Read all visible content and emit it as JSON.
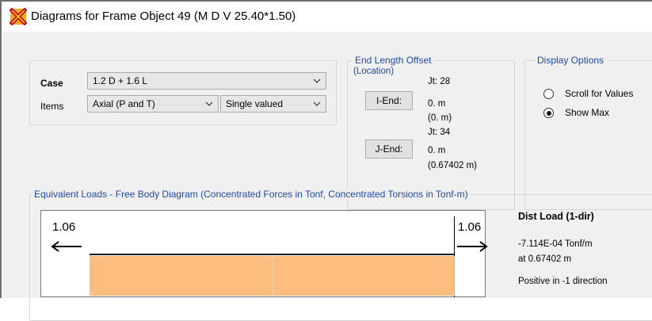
{
  "window": {
    "title": "Diagrams for Frame Object 49  (M D V 25.40*1.50)",
    "app_icon": "sap2000-x-icon"
  },
  "case_group": {
    "case_label": "Case",
    "case_value": "1.2 D + 1.6 L",
    "items_label": "Items",
    "items_value": "Axial (P and T)",
    "valued_value": "Single valued"
  },
  "end_offset": {
    "title": "End Length Offset",
    "location_label": "(Location)",
    "i_end": {
      "button": "I-End:",
      "jt": "Jt:  28",
      "value": "0. m",
      "location": "(0. m)"
    },
    "j_end": {
      "button": "J-End:",
      "jt": "Jt:  34",
      "value": "0. m",
      "location": "(0.67402 m)"
    }
  },
  "display_options": {
    "title": "Display Options",
    "options": [
      {
        "label": "Scroll for Values",
        "selected": false
      },
      {
        "label": "Show Max",
        "selected": true
      }
    ]
  },
  "equivalent_loads": {
    "title": "Equivalent Loads - Free Body Diagram  (Concentrated Forces in Tonf, Concentrated Torsions in Tonf-m)",
    "left_force": "1.06",
    "right_force": "1.06",
    "bar_color": "#fdbd7f",
    "dist_load": {
      "header": "Dist Load (1-dir)",
      "value": "-7.114E-04 Tonf/m",
      "at": "at 0.67402 m",
      "direction": "Positive in -1 direction"
    }
  }
}
